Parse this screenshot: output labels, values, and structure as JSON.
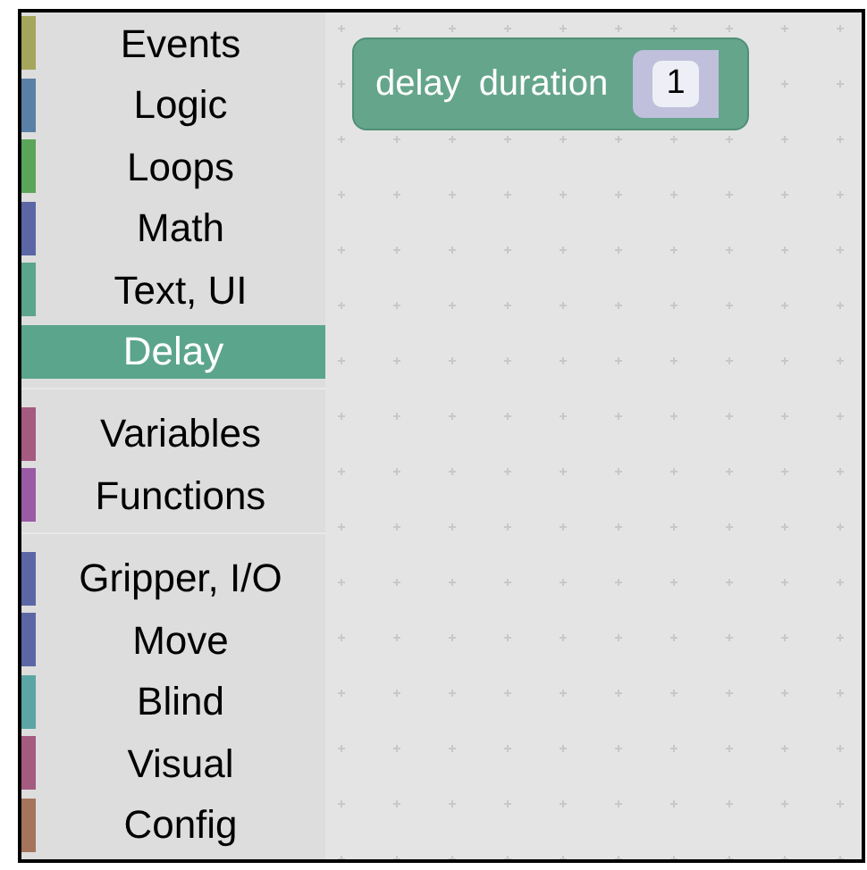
{
  "toolbox": {
    "groups": [
      {
        "categories": [
          {
            "label": "Events",
            "color": "#a5a55b",
            "selected": false
          },
          {
            "label": "Logic",
            "color": "#5b80a5",
            "selected": false
          },
          {
            "label": "Loops",
            "color": "#5ba55b",
            "selected": false
          },
          {
            "label": "Math",
            "color": "#5b67a5",
            "selected": false
          },
          {
            "label": "Text, UI",
            "color": "#5ba58c",
            "selected": false
          },
          {
            "label": "Delay",
            "color": "#5ba58c",
            "selected": true
          }
        ]
      },
      {
        "categories": [
          {
            "label": "Variables",
            "color": "#a55b80",
            "selected": false
          },
          {
            "label": "Functions",
            "color": "#995ba5",
            "selected": false
          }
        ]
      },
      {
        "categories": [
          {
            "label": "Gripper, I/O",
            "color": "#5b67a5",
            "selected": false
          },
          {
            "label": "Move",
            "color": "#5b67a5",
            "selected": false
          },
          {
            "label": "Blind",
            "color": "#5ba5a5",
            "selected": false
          },
          {
            "label": "Visual",
            "color": "#a55b80",
            "selected": false
          },
          {
            "label": "Config",
            "color": "#a5745b",
            "selected": false
          }
        ]
      }
    ]
  },
  "workspace": {
    "block": {
      "words": [
        "delay",
        "duration"
      ],
      "value": "1"
    }
  }
}
